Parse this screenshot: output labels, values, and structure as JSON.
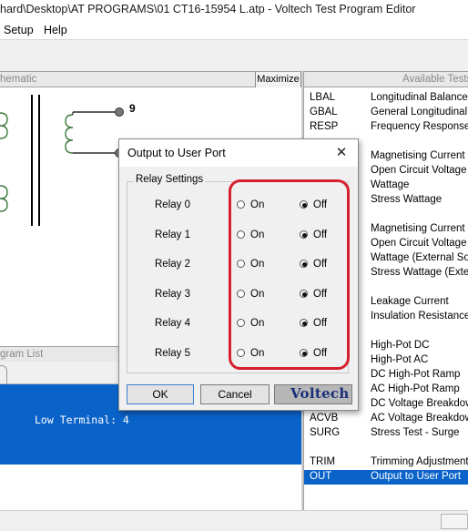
{
  "window": {
    "title": "hard\\Desktop\\AT PROGRAMS\\01 CT16-15954 L.atp - Voltech Test Program Editor"
  },
  "menu": {
    "items": [
      "Setup",
      "Help"
    ]
  },
  "schematic_pane": {
    "header": "hematic",
    "maximize_label": "Maximize",
    "node_label": "9"
  },
  "program_pane": {
    "header": "gram List",
    "low_terminal_text": "Low Terminal: 4"
  },
  "available_tests": {
    "header": "Available Tests",
    "rows": [
      {
        "code": "LBAL",
        "desc": "Longitudinal Balance"
      },
      {
        "code": "GBAL",
        "desc": "General Longitudinal B"
      },
      {
        "code": "RESP",
        "desc": "Frequency Response"
      },
      {
        "code": "",
        "desc": "Magnetising Current"
      },
      {
        "code": "",
        "desc": "Open Circuit Voltage"
      },
      {
        "code": "",
        "desc": "Wattage"
      },
      {
        "code": "",
        "desc": "Stress Wattage"
      },
      {
        "code": "",
        "desc": "Magnetising Current (E"
      },
      {
        "code": "",
        "desc": "Open Circuit Voltage (E"
      },
      {
        "code": "",
        "desc": "Wattage (External Sou"
      },
      {
        "code": "",
        "desc": "Stress Wattage (Extern"
      },
      {
        "code": "",
        "desc": "Leakage Current"
      },
      {
        "code": "",
        "desc": "Insulation Resistance"
      },
      {
        "code": "",
        "desc": "High-Pot DC"
      },
      {
        "code": "",
        "desc": "High-Pot AC"
      },
      {
        "code": "",
        "desc": "DC High-Pot Ramp"
      },
      {
        "code": "",
        "desc": "AC High-Pot Ramp"
      },
      {
        "code": "",
        "desc": "DC Voltage Breakdown"
      },
      {
        "code": "ACVB",
        "desc": "AC Voltage Breakdown"
      },
      {
        "code": "SURG",
        "desc": "Stress Test - Surge"
      },
      {
        "code": "TRIM",
        "desc": "Trimming Adjustment"
      },
      {
        "code": "OUT",
        "desc": "Output to User Port"
      }
    ],
    "selected_index": 21
  },
  "dialog": {
    "title": "Output to User Port",
    "close_glyph": "✕",
    "group_label": "Relay Settings",
    "on_label": "On",
    "off_label": "Off",
    "relays": [
      {
        "label": "Relay 0",
        "state": "Off"
      },
      {
        "label": "Relay 1",
        "state": "Off"
      },
      {
        "label": "Relay 2",
        "state": "Off"
      },
      {
        "label": "Relay 3",
        "state": "Off"
      },
      {
        "label": "Relay 4",
        "state": "Off"
      },
      {
        "label": "Relay 5",
        "state": "Off"
      }
    ],
    "ok_label": "OK",
    "cancel_label": "Cancel",
    "logo_text": "Voltech"
  },
  "colors": {
    "selection_blue": "#0a63c9",
    "highlight_red": "#d6202f",
    "logo_blue": "#1c2f7a"
  }
}
